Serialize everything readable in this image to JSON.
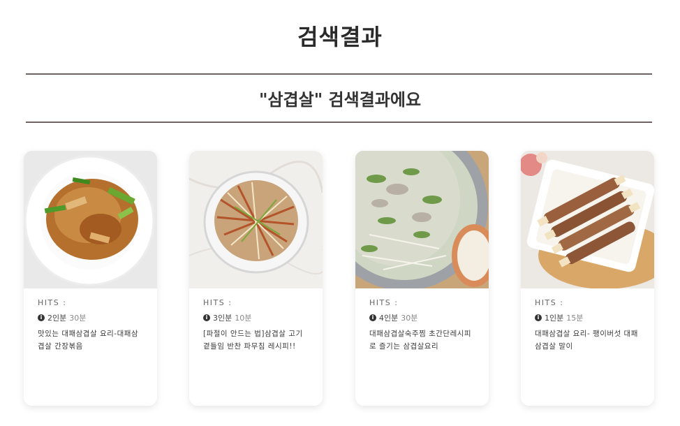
{
  "page": {
    "title": "검색결과",
    "subtitle": "\"삼겹살\" 검색결과에요"
  },
  "cards": [
    {
      "hits": "HITS :",
      "servings": "2인분",
      "time": "30분",
      "description": "맛있는 대패삼겹살 요리-대패삼겹살 간장볶음",
      "image": "stir-fried-pork-plate"
    },
    {
      "hits": "HITS :",
      "servings": "3인분",
      "time": "10분",
      "description": "[파절이 안드는 법]삼겹살 고기 곁들임 반찬 파무침 레시피!!",
      "image": "green-onion-salad-bowl"
    },
    {
      "hits": "HITS :",
      "servings": "4인분",
      "time": "30분",
      "description": "대패삼겹살숙주찜 초간단레시피로 즐기는 삼겹살요리",
      "image": "steamed-pork-bean-sprouts-pan"
    },
    {
      "hits": "HITS :",
      "servings": "1인분",
      "time": "15분",
      "description": "대패삼겹살 요리- 팽이버섯 대패삼겹살 말이",
      "image": "pork-enoki-rolls-plate"
    }
  ],
  "icons": {
    "servings": "info-icon"
  }
}
